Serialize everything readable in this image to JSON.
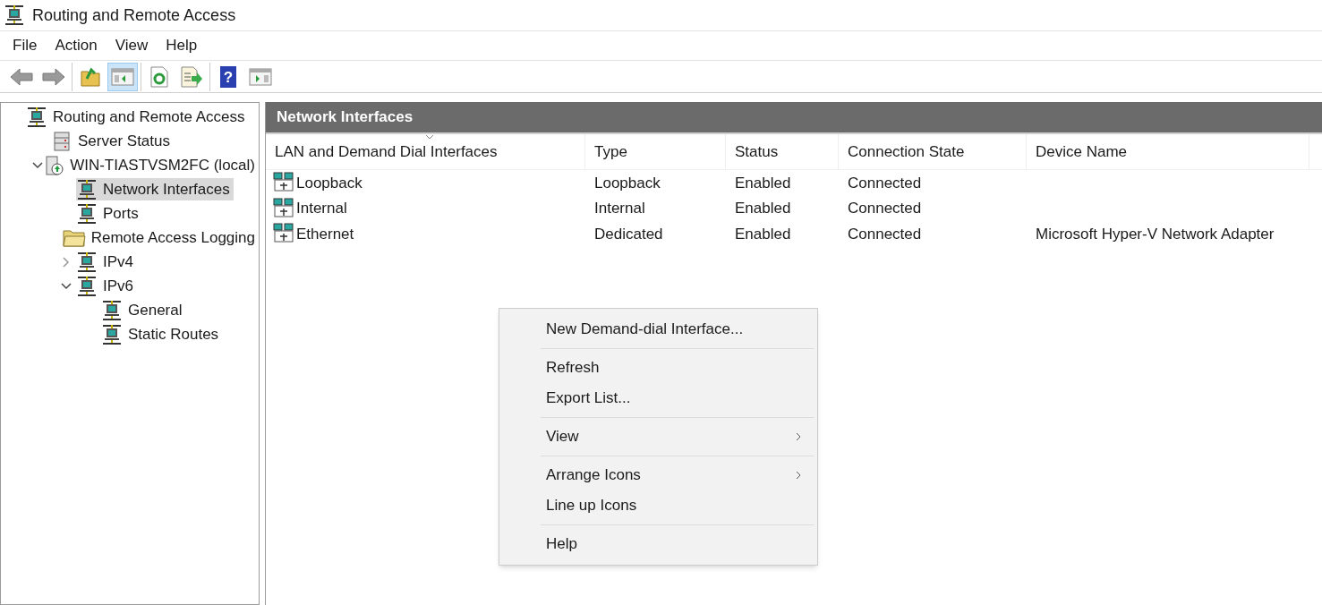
{
  "window": {
    "title": "Routing and Remote Access"
  },
  "menu": [
    "File",
    "Action",
    "View",
    "Help"
  ],
  "toolbar": [
    [
      {
        "kind": "back",
        "pressed": false
      },
      {
        "kind": "forward",
        "pressed": false
      }
    ],
    [
      {
        "kind": "up",
        "pressed": false
      },
      {
        "kind": "tree",
        "pressed": true
      }
    ],
    [
      {
        "kind": "refresh",
        "pressed": false
      },
      {
        "kind": "export",
        "pressed": false
      }
    ],
    [
      {
        "kind": "help",
        "pressed": false,
        "glyph": "?"
      },
      {
        "kind": "action-pane",
        "pressed": false
      }
    ]
  ],
  "tree": [
    {
      "label": "Routing and Remote Access",
      "kind": "network",
      "selected": false,
      "children": [
        {
          "label": "Server Status",
          "kind": "servers",
          "selected": false
        },
        {
          "label": "WIN-TIASTVSM2FC (local)",
          "kind": "server",
          "selected": false,
          "expanded": true,
          "children": [
            {
              "label": "Network Interfaces",
              "kind": "network",
              "selected": true
            },
            {
              "label": "Ports",
              "kind": "network",
              "selected": false
            },
            {
              "label": "Remote Access Logging",
              "kind": "folder",
              "selected": false
            },
            {
              "label": "IPv4",
              "kind": "network",
              "selected": false,
              "expanded": false
            },
            {
              "label": "IPv6",
              "kind": "network",
              "selected": false,
              "expanded": true,
              "children": [
                {
                  "label": "General",
                  "kind": "network",
                  "selected": false
                },
                {
                  "label": "Static Routes",
                  "kind": "network",
                  "selected": false
                }
              ]
            }
          ]
        }
      ]
    }
  ],
  "panel": {
    "title": "Network Interfaces"
  },
  "table": {
    "columns": [
      {
        "label": "LAN and Demand Dial Interfaces",
        "sorted": true
      },
      {
        "label": "Type",
        "sorted": false
      },
      {
        "label": "Status",
        "sorted": false
      },
      {
        "label": "Connection State",
        "sorted": false
      },
      {
        "label": "Device Name",
        "sorted": false
      }
    ],
    "rows": [
      [
        "Loopback",
        "Loopback",
        "Enabled",
        "Connected",
        ""
      ],
      [
        "Internal",
        "Internal",
        "Enabled",
        "Connected",
        ""
      ],
      [
        "Ethernet",
        "Dedicated",
        "Enabled",
        "Connected",
        "Microsoft Hyper-V Network Adapter"
      ]
    ]
  },
  "context_menu": [
    [
      {
        "label": "New Demand-dial Interface...",
        "submenu": false
      }
    ],
    [
      {
        "label": "Refresh",
        "submenu": false
      },
      {
        "label": "Export List...",
        "submenu": false
      }
    ],
    [
      {
        "label": "View",
        "submenu": true
      }
    ],
    [
      {
        "label": "Arrange Icons",
        "submenu": true
      },
      {
        "label": "Line up Icons",
        "submenu": false
      }
    ],
    [
      {
        "label": "Help",
        "submenu": false
      }
    ]
  ]
}
